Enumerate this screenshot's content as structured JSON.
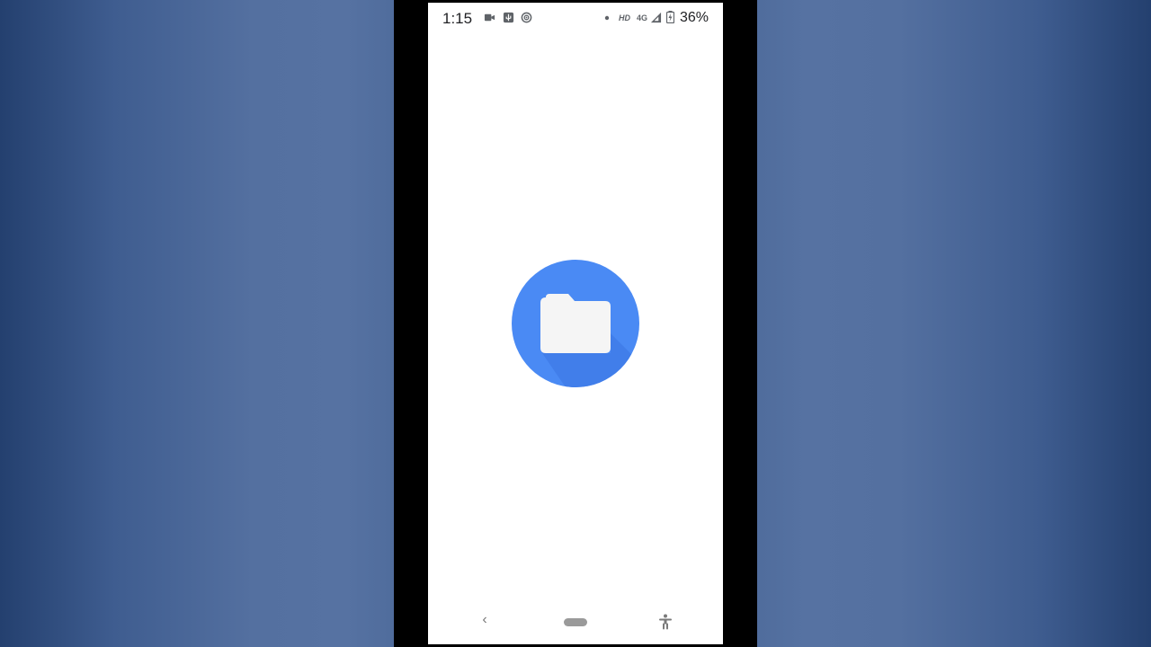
{
  "status_bar": {
    "time": "1:15",
    "network_label": "HD",
    "network_type": "4G",
    "battery_percent": "36%",
    "icons": [
      "video-camera-icon",
      "usb-icon",
      "hotspot-icon",
      "notification-dot-icon",
      "signal-icon",
      "battery-charging-icon"
    ]
  },
  "splash": {
    "icon": "folder-icon",
    "circle_color": "#4285f4",
    "folder_color": "#f5f5f5"
  },
  "nav_bar": {
    "back_glyph": "‹",
    "icons": [
      "back-icon",
      "home-pill-icon",
      "accessibility-icon"
    ]
  },
  "colors": {
    "backdrop_blue": "#5672a2",
    "frame": "#000000",
    "screen": "#ffffff"
  }
}
